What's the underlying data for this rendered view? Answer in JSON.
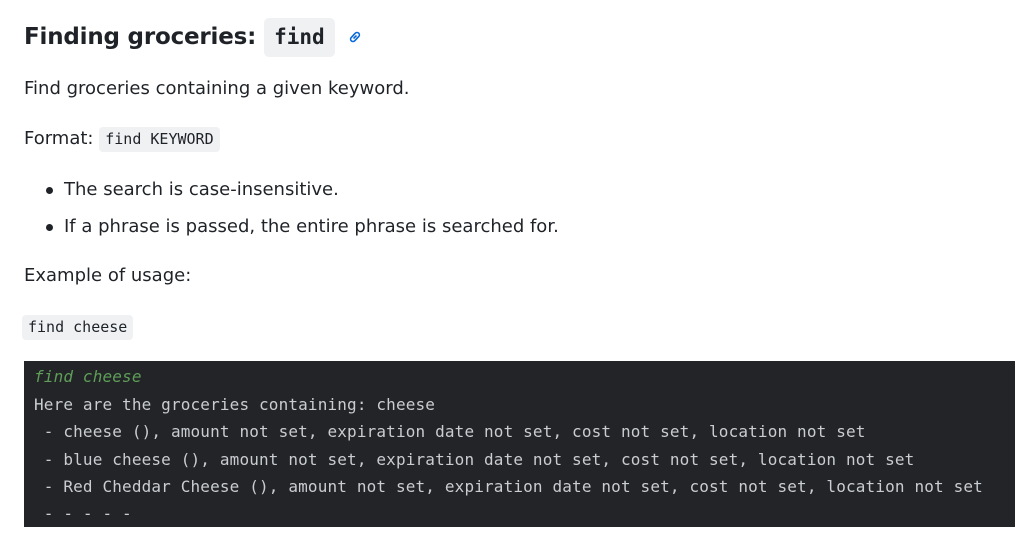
{
  "heading": {
    "text": "Finding groceries:",
    "code": "find",
    "anchor_icon": "link-icon"
  },
  "description": "Find groceries containing a given keyword.",
  "format": {
    "label": "Format:",
    "code": "find KEYWORD"
  },
  "bullets": [
    "The search is case-insensitive.",
    "If a phrase is passed, the entire phrase is searched for."
  ],
  "example": {
    "label": "Example of usage:",
    "code": "find cheese"
  },
  "terminal": {
    "lines": [
      "find cheese",
      "Here are the groceries containing: cheese",
      " - cheese (), amount not set, expiration date not set, cost not set, location not set",
      " - blue cheese (), amount not set, expiration date not set, cost not set, location not set",
      " - Red Cheddar Cheese (), amount not set, expiration date not set, cost not set, location not set",
      " - - - - -"
    ]
  },
  "colors": {
    "text": "#1f2328",
    "code_bg": "#eff1f3",
    "terminal_bg": "#222427",
    "terminal_text": "#c9ccd1",
    "terminal_command": "#5f9e59",
    "link": "#0969da"
  }
}
